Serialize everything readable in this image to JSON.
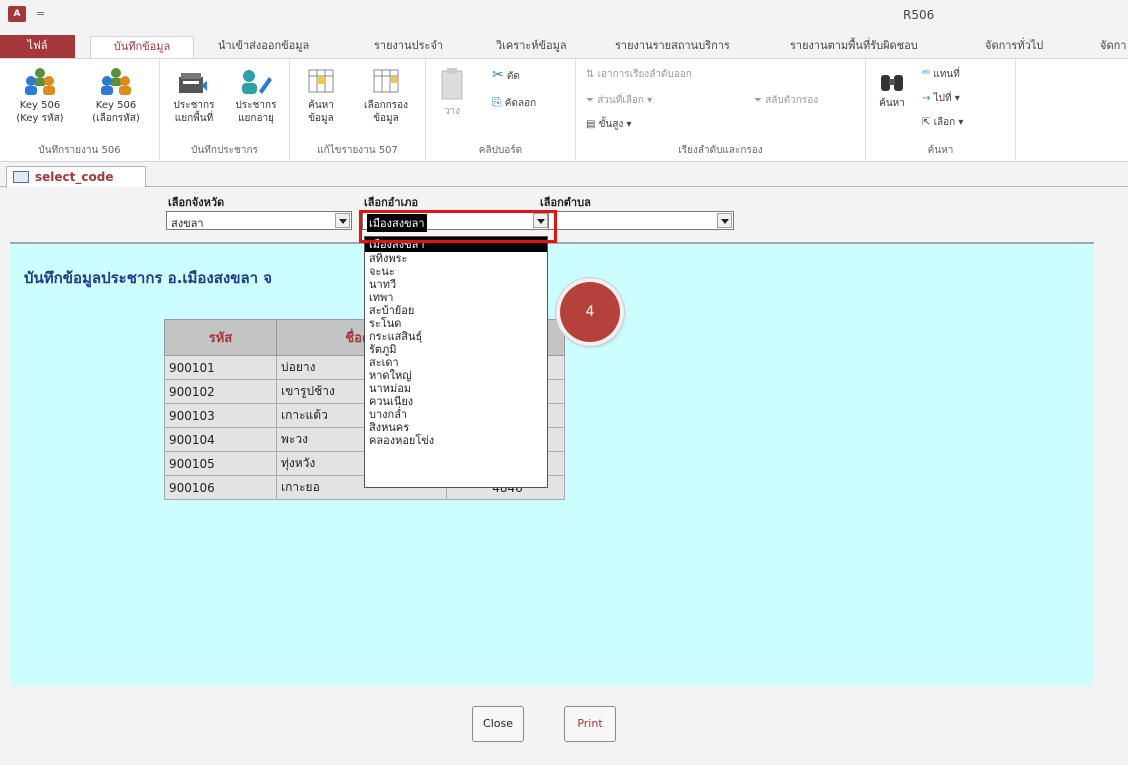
{
  "titlebar": {
    "app_icon": "A",
    "qat_arrow": "=",
    "window_title": "R506"
  },
  "tabs": [
    "ไฟล์",
    "บันทึกข้อมูล",
    "นำเข้าส่งออกข้อมูล",
    "รายงานประจำ",
    "วิเคราะห์ข้อมูล",
    "รายงานรายสถานบริการ",
    "รายงานตามพื้นที่รับผิดชอบ",
    "จัดการทั่วไป",
    "จัดกา"
  ],
  "ribbon": {
    "group1": {
      "btn1": [
        "Key 506",
        "(Key รหัส)"
      ],
      "btn2": [
        "Key 506",
        "(เลือกรหัส)"
      ],
      "label": "บันทึกรายงาน 506"
    },
    "group2": {
      "btn1": [
        "ประชากร",
        "แยกพื้นที่"
      ],
      "btn2": [
        "ประชากร",
        "แยกอายุ"
      ],
      "label": "บันทึกประชากร"
    },
    "group3": {
      "btn1": [
        "ค้นหา",
        "ข้อมูล"
      ],
      "btn2": [
        "เลือกกรอง",
        "ข้อมูล"
      ],
      "label": "แก้ไขรายงาน 507"
    },
    "group4": {
      "paste": "วาง",
      "cut": "ตัด",
      "copy": "คัดลอก",
      "label": "คลิปบอร์ด"
    },
    "group5": {
      "remove_sort": "เอาการเรียงลำดับออก",
      "selection": "ส่วนที่เลือก ▾",
      "advanced": "ขั้นสูง ▾",
      "toggle": "สลับตัวกรอง",
      "label": "เรียงลำดับและกรอง"
    },
    "group6": {
      "find": "ค้นหา",
      "replace": "แทนที่",
      "goto": "ไปที่ ▾",
      "select": "เลือก ▾",
      "label": "ค้นหา"
    }
  },
  "doc_tab": {
    "label": "select_code"
  },
  "form": {
    "province_label": "เลือกจังหวัด",
    "province_value": "สงขลา",
    "district_label": "เลือกอำเภอ",
    "district_value": "เมืองสงขลา",
    "subdistrict_label": "เลือกตำบล",
    "subdistrict_value": ""
  },
  "detail": {
    "heading": "บันทึกข้อมูลประชากร    อ.เมืองสงขลา จ",
    "table": {
      "headers": [
        "รหัส",
        "ชื่อตำ",
        "ร"
      ],
      "rows": [
        [
          "900101",
          "บ่อยาง",
          ""
        ],
        [
          "900102",
          "เขารูปช้าง",
          ""
        ],
        [
          "900103",
          "เกาะแต้ว",
          ""
        ],
        [
          "900104",
          "พะวง",
          ""
        ],
        [
          "900105",
          "ทุ่งหวัง",
          ""
        ],
        [
          "900106",
          "เกาะยอ",
          "4846"
        ]
      ]
    }
  },
  "dropdown": {
    "items": [
      "เมืองสงขลา",
      "สทิงพระ",
      "จะนะ",
      "นาทวี",
      "เทพา",
      "สะบ้าย้อย",
      "ระโนด",
      "กระแสสินธุ์",
      "รัตภูมิ",
      "สะเดา",
      "หาดใหญ่",
      "นาหม่อม",
      "ควนเนียง",
      "บางกล่ำ",
      "สิงหนคร",
      "คลองหอยโข่ง"
    ]
  },
  "step_badge": "4",
  "footer": {
    "close": "Close",
    "print": "Print"
  },
  "colors": {
    "accent": "#a4373a",
    "detail_bg": "#ccfdff",
    "highlight": "#e01414",
    "badge": "#b5413a"
  }
}
